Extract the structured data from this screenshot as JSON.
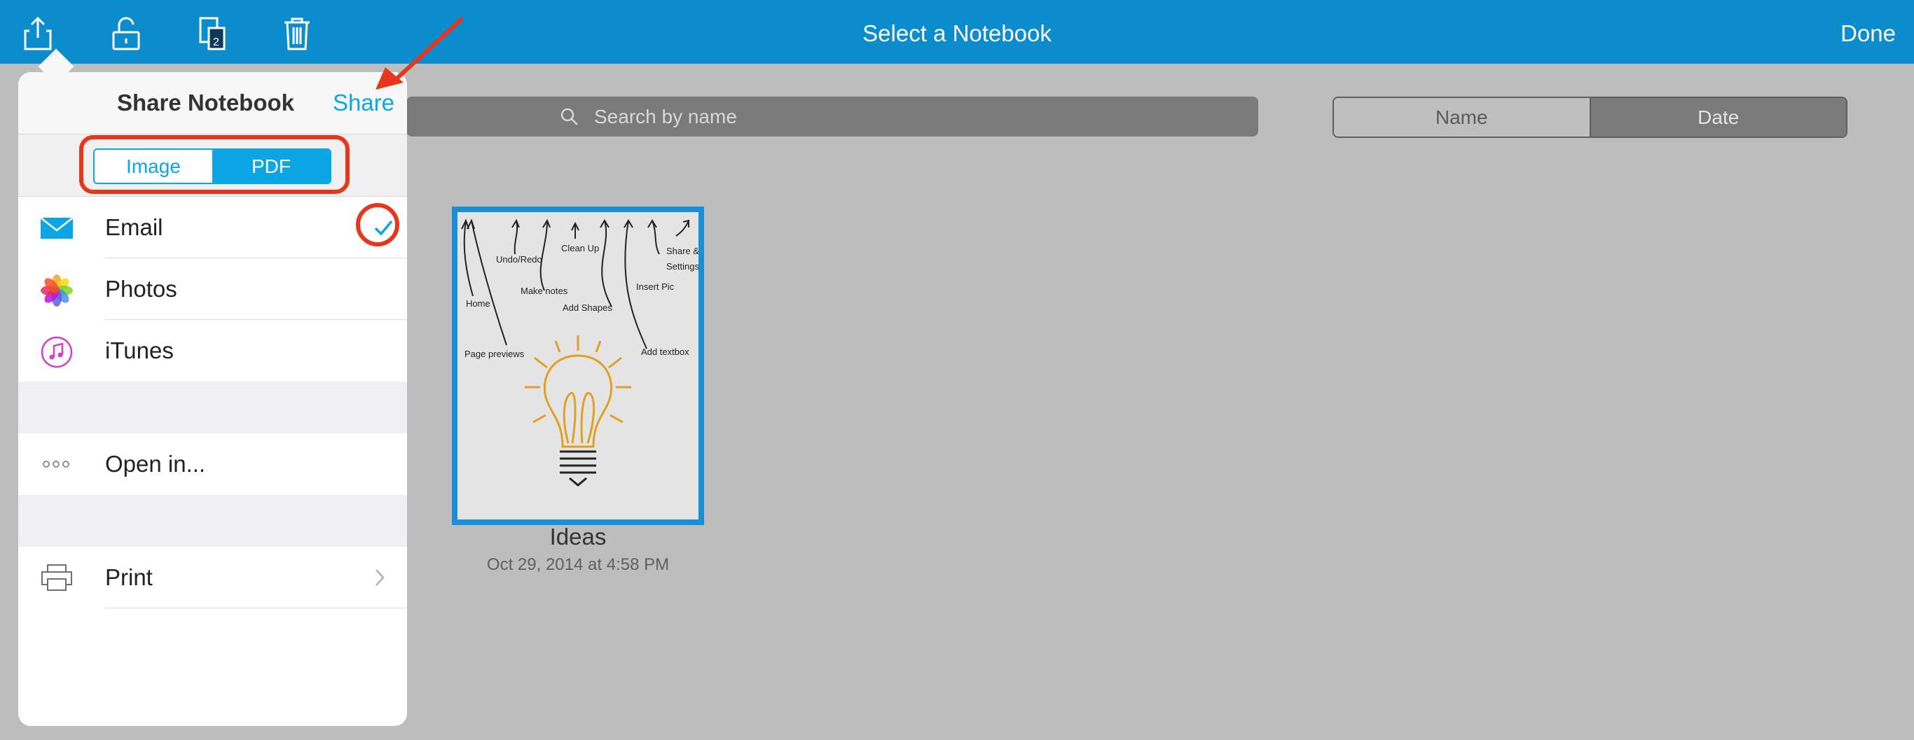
{
  "nav": {
    "title": "Select a Notebook",
    "done_label": "Done",
    "icons": [
      "share-icon",
      "unlock-icon",
      "page-move-icon",
      "trash-icon"
    ],
    "page_badge": "2"
  },
  "search": {
    "placeholder": "Search by name"
  },
  "sort": {
    "name_label": "Name",
    "date_label": "Date",
    "selected": "Date"
  },
  "notebook": {
    "title": "Ideas",
    "date": "Oct 29, 2014 at 4:58 PM",
    "labels": [
      "Undo/Redo",
      "Clean Up",
      "Share &",
      "Settings",
      "Home",
      "Make notes",
      "Insert Pic",
      "Add Shapes",
      "Add textbox",
      "Page previews"
    ]
  },
  "popover": {
    "title": "Share Notebook",
    "share_label": "Share",
    "type_options": [
      "Image",
      "PDF"
    ],
    "selected_type": "PDF",
    "rows": [
      {
        "label": "Email",
        "icon": "mail-icon",
        "checked": true
      },
      {
        "label": "Photos",
        "icon": "photos-icon"
      },
      {
        "label": "iTunes",
        "icon": "itunes-icon"
      },
      {
        "label": "Open in...",
        "icon": "more-icon"
      },
      {
        "label": "Print",
        "icon": "printer-icon",
        "disclosure": true
      }
    ]
  },
  "colors": {
    "nav_bar": "#0b8dcd",
    "accent": "#0aa6e6",
    "highlight": "#e8361d",
    "thumb_border": "#1a8fd6"
  }
}
